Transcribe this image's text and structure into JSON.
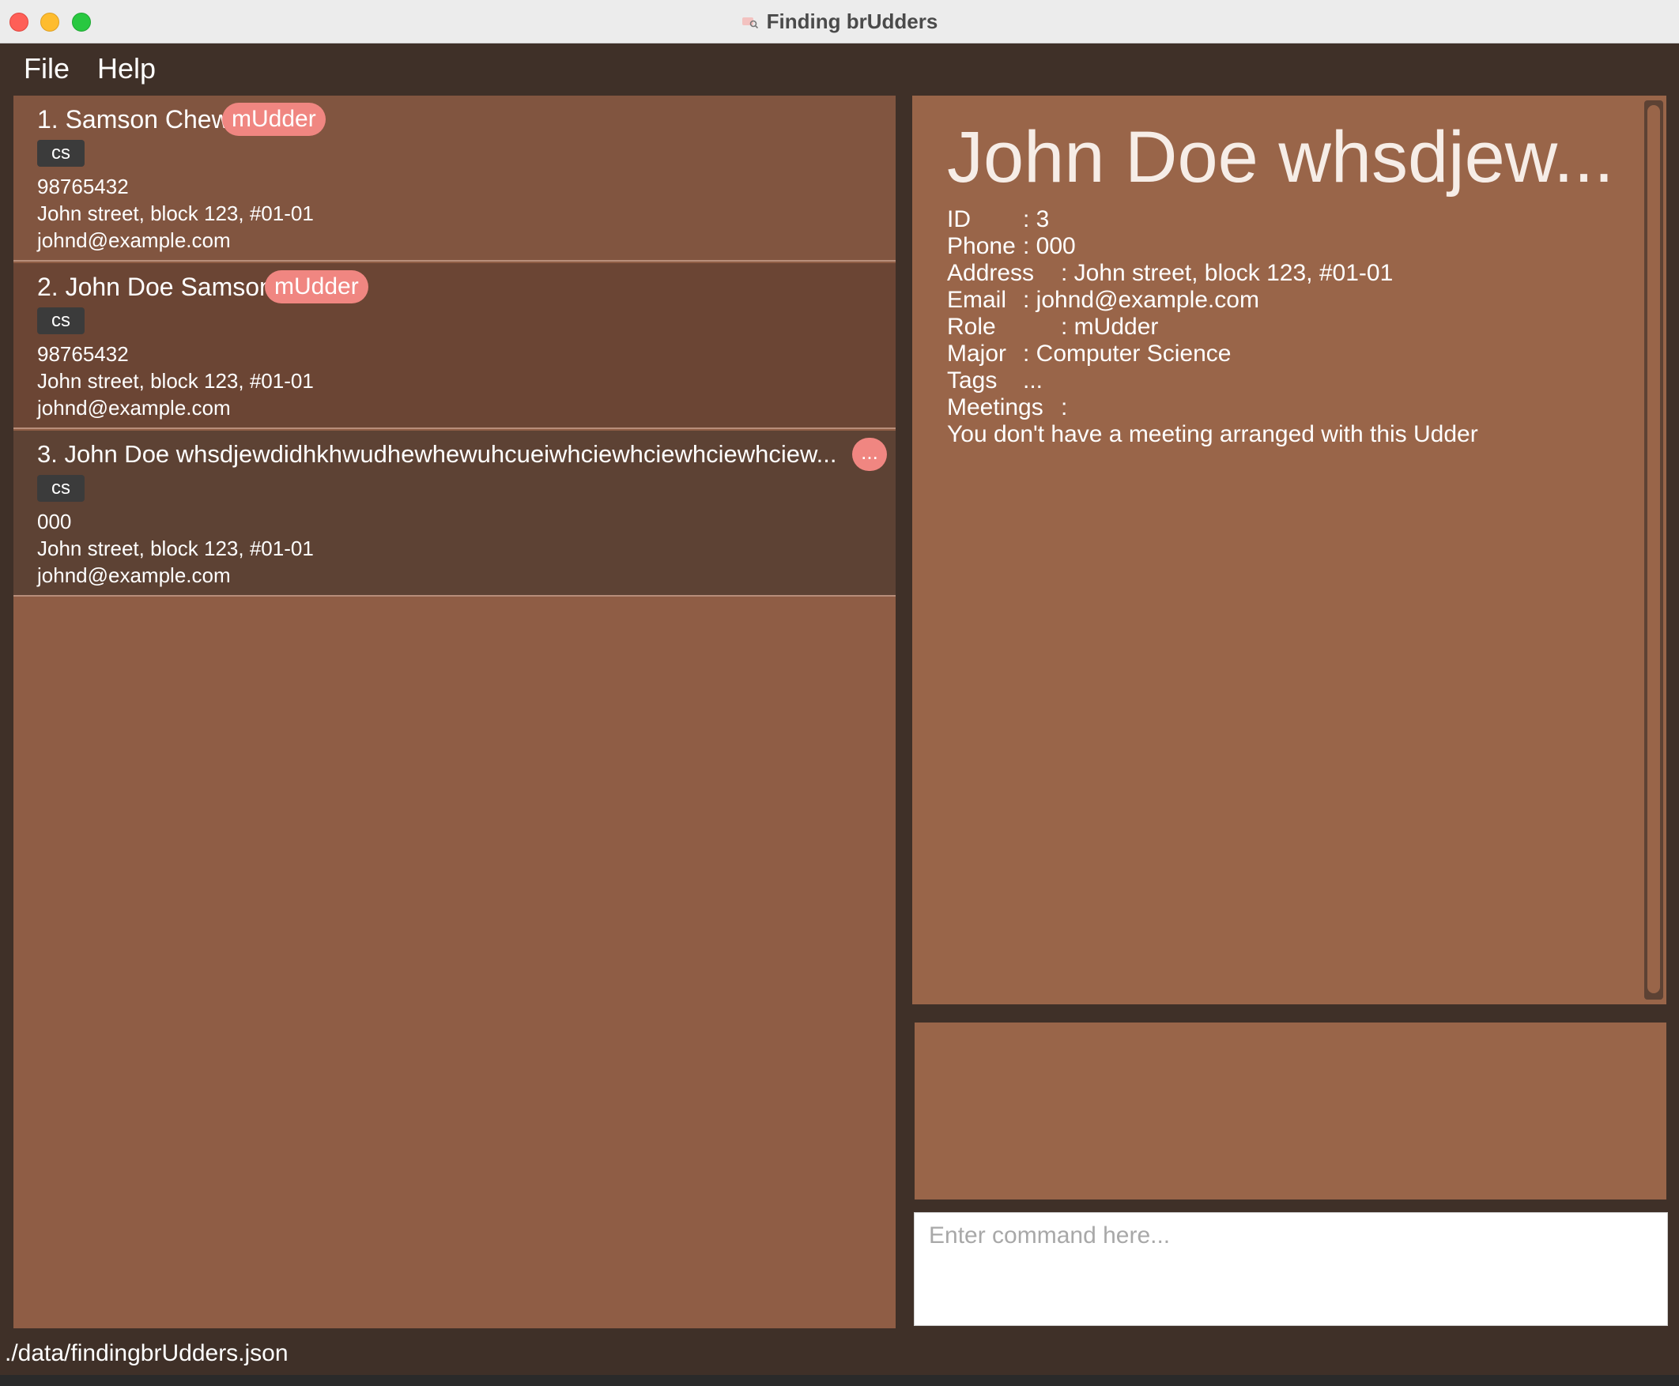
{
  "window": {
    "title": "Finding brUdders"
  },
  "menu": {
    "file": "File",
    "help": "Help"
  },
  "persons": [
    {
      "name": "1. Samson Chew",
      "role": "mUdder",
      "tag": "cs",
      "phone": "98765432",
      "address": "John street, block 123, #01-01",
      "email": "johnd@example.com"
    },
    {
      "name": "2. John Doe Samson",
      "role": "mUdder",
      "tag": "cs",
      "phone": "98765432",
      "address": "John street, block 123, #01-01",
      "email": "johnd@example.com"
    },
    {
      "name": "3. John Doe whsdjewdidhkhwudhewhewuhcueiwhciewhciewhciewhciew...",
      "role": "...",
      "tag": "cs",
      "phone": "000",
      "address": "John street, block 123, #01-01",
      "email": "johnd@example.com"
    }
  ],
  "detail": {
    "name": "John Doe whsdjew...",
    "rows": [
      {
        "label": "ID",
        "value": ": 3"
      },
      {
        "label": "Phone",
        "value": ": 000"
      },
      {
        "label": "Address",
        "value": ": John street, block 123, #01-01"
      },
      {
        "label": "Email",
        "value": ": johnd@example.com"
      },
      {
        "label": "Role",
        "value": ": mUdder"
      },
      {
        "label": "Major",
        "value": ": Computer Science"
      },
      {
        "label": "Tags",
        "value": "..."
      },
      {
        "label": "Meetings",
        "value": ":"
      }
    ],
    "meeting_note": "You don't have a meeting arranged with this Udder"
  },
  "command": {
    "placeholder": "Enter command here..."
  },
  "status": {
    "path": "./data/findingbrUdders.json"
  },
  "colors": {
    "window_bg": "#3f3028",
    "list_bg": "#8f5d45",
    "detail_bg": "#996549",
    "badge": "#f08681",
    "tag_bg": "#3b3b3b"
  }
}
